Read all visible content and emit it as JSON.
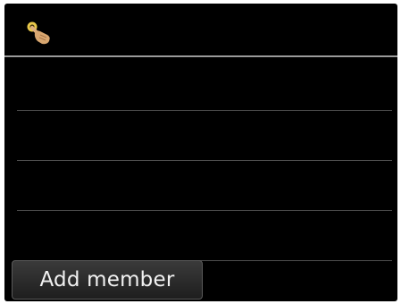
{
  "header": {
    "icon": "touch-hand-icon"
  },
  "member_list": {
    "rows": [
      "",
      "",
      "",
      ""
    ]
  },
  "footer": {
    "add_member_label": "Add member"
  },
  "colors": {
    "screen_background": "#000000",
    "divider": "#9a9a9a",
    "button_text": "#f2f2f2",
    "icon_yellow": "#e8c84a",
    "icon_hand": "#d9a770"
  }
}
